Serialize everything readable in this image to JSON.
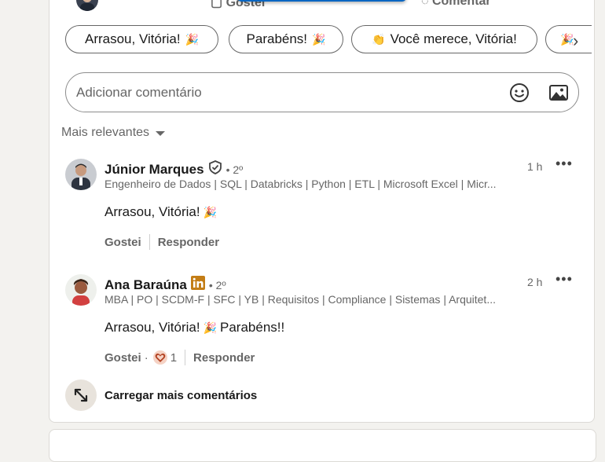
{
  "top_actions": {
    "like_label": "Gostei",
    "comment_label": "Comentar"
  },
  "suggestions": [
    {
      "text": "Arrasou, Vitória!",
      "emoji": "🎉"
    },
    {
      "text": "Parabéns!",
      "emoji": "🎉"
    },
    {
      "text": "Você merece, Vitória!",
      "emoji": "👏"
    },
    {
      "text": "",
      "emoji": "🎉"
    }
  ],
  "chip_next_arrow": "›",
  "comment_input": {
    "placeholder": "Adicionar comentário",
    "emoji_icon": "smiley-icon",
    "image_icon": "image-icon"
  },
  "sort": {
    "label": "Mais relevantes"
  },
  "comments": [
    {
      "name": "Júnior Marques",
      "badge": "verified-shield-icon",
      "degree": "• 2º",
      "headline": "Engenheiro de Dados | SQL | Databricks | Python | ETL | Microsoft Excel | Micr...",
      "time": "1 h",
      "more": "•••",
      "text": "Arrasou, Vitória!",
      "text_emoji": "🎉",
      "like_label": "Gostei",
      "reply_label": "Responder"
    },
    {
      "name": "Ana Baraúna",
      "badge": "linkedin-premium-icon",
      "degree": "• 2º",
      "headline": "MBA | PO | SCDM-F | SFC | YB | Requisitos | Compliance | Sistemas | Arquitet...",
      "time": "2 h",
      "more": "•••",
      "text": "Arrasou, Vitória!",
      "text_emoji": "🎉",
      "text_after": "Parabéns!!",
      "like_label": "Gostei",
      "reaction_separator": "·",
      "reaction_count": "1",
      "reply_label": "Responder"
    }
  ],
  "load_more": {
    "label": "Carregar mais comentários"
  },
  "colors": {
    "accent": "#0a66c2",
    "background": "#f3f2ef",
    "card": "#ffffff",
    "muted_text": "#666666",
    "premium_gold": "#c37d16"
  }
}
